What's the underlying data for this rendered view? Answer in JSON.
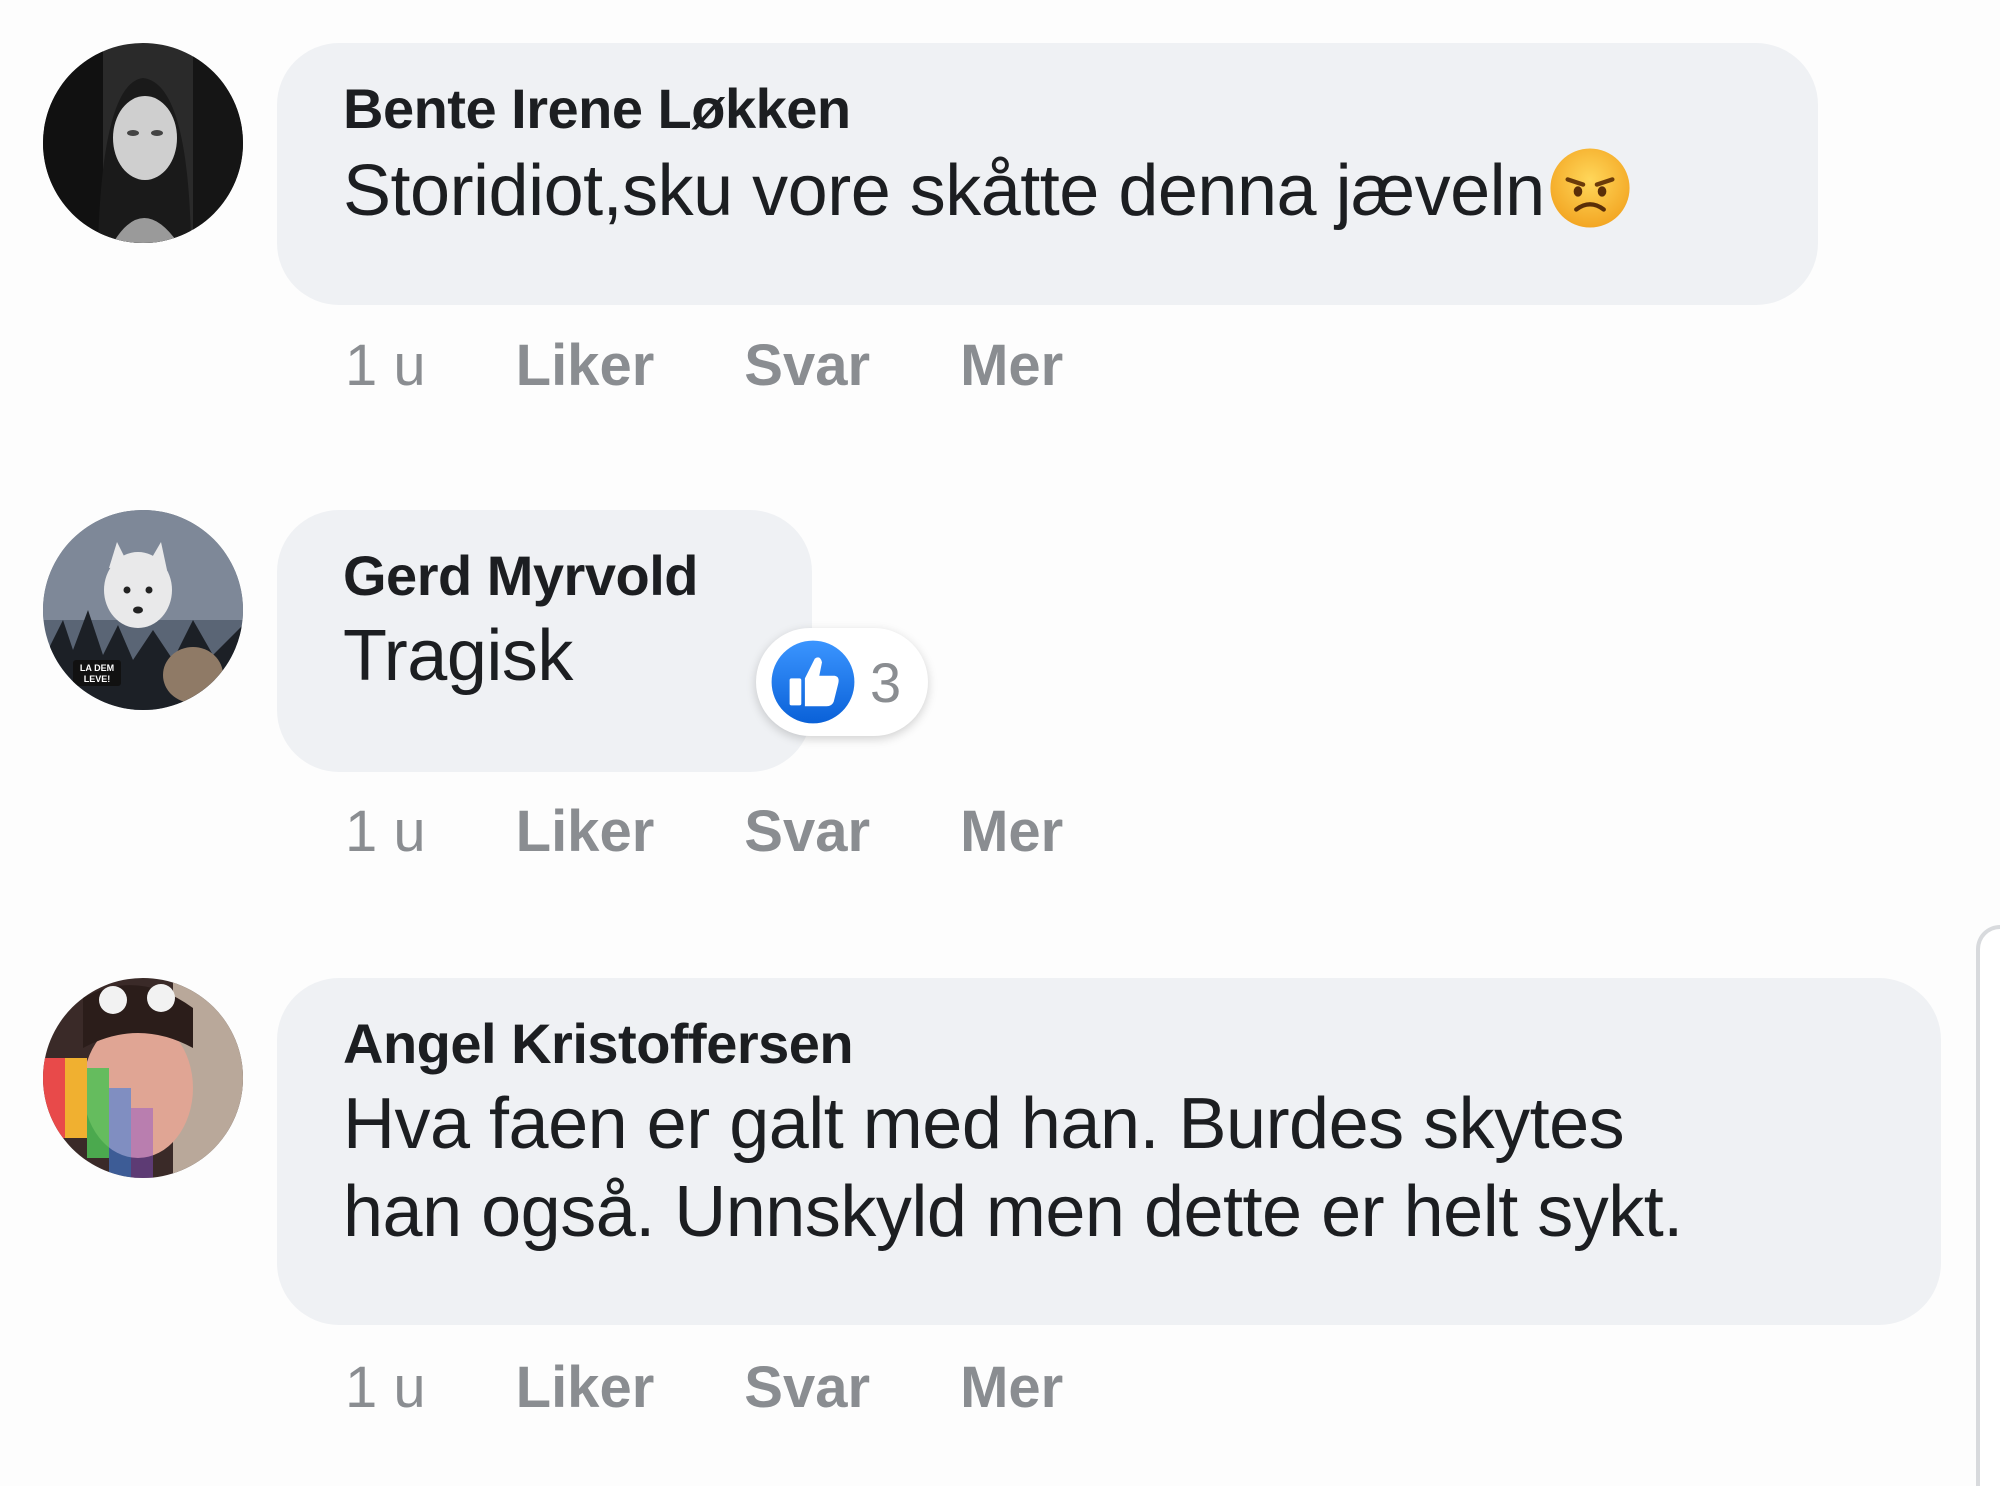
{
  "comments": [
    {
      "author": "Bente Irene Løkken",
      "text": "Storidiot,sku vore skåtte denna jæveln",
      "emoji": "angry-face-emoji",
      "time": "1 u",
      "actions": {
        "like": "Liker",
        "reply": "Svar",
        "more": "Mer"
      }
    },
    {
      "author": "Gerd Myrvold",
      "text": "Tragisk",
      "reaction": {
        "icon": "thumbs-up-icon",
        "count": "3",
        "color": "#1877f2"
      },
      "time": "1 u",
      "actions": {
        "like": "Liker",
        "reply": "Svar",
        "more": "Mer"
      },
      "avatar_badge": "LA DEM LEVE!"
    },
    {
      "author": "Angel Kristoffersen",
      "text_line1": "Hva faen er galt med han. Burdes skytes",
      "text_line2": "han også. Unnskyld men dette er helt sykt.",
      "time": "1 u",
      "actions": {
        "like": "Liker",
        "reply": "Svar",
        "more": "Mer"
      }
    }
  ],
  "colors": {
    "bubble": "#eff1f4",
    "text": "#1c1e21",
    "meta": "#8a8d91",
    "like_blue": "#1877f2"
  }
}
